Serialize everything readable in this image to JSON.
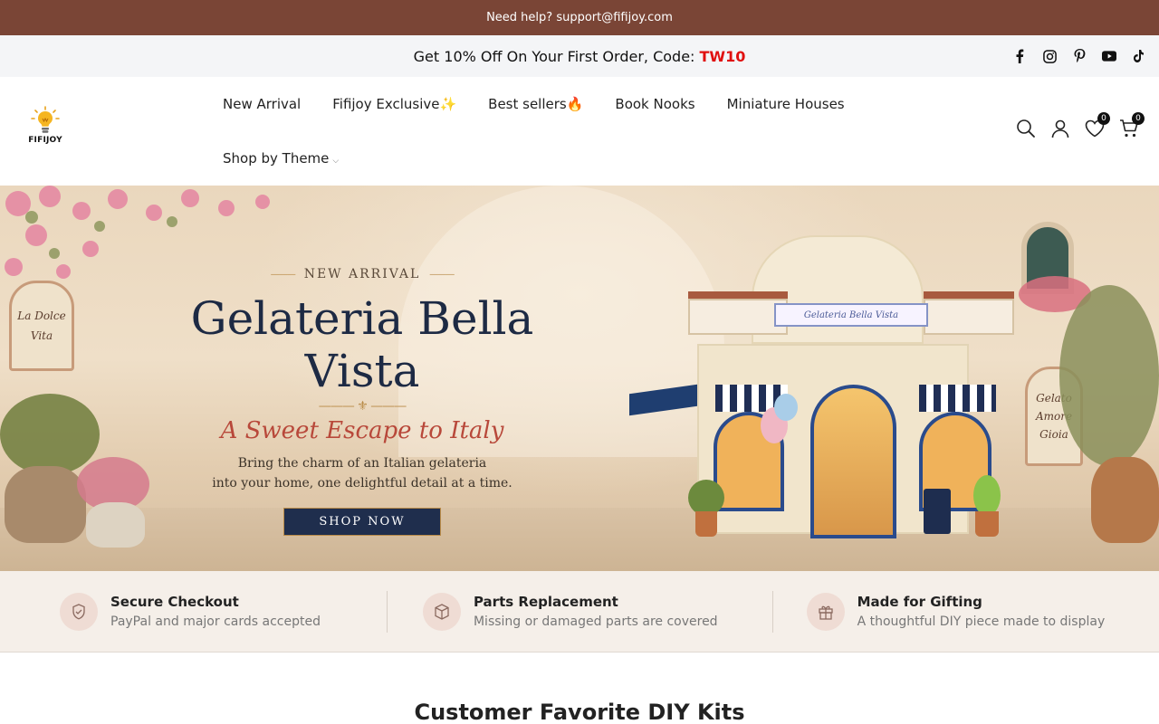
{
  "topbar": {
    "text": "Need help? support@fifijoy.com"
  },
  "promo": {
    "text": "Get 10% Off On Your First Order, Code: ",
    "code": "TW10"
  },
  "social": [
    "facebook-icon",
    "instagram-icon",
    "pinterest-icon",
    "youtube-icon",
    "tiktok-icon"
  ],
  "logo": {
    "name": "FIFIJOY",
    "tagline": ""
  },
  "nav": {
    "items": [
      "New Arrival",
      "Fifijoy Exclusive✨",
      "Best sellers🔥",
      "Book Nooks",
      "Miniature Houses"
    ],
    "shop_by_theme": "Shop by Theme"
  },
  "header_icons": {
    "wishlist_count": "0",
    "cart_count": "0"
  },
  "hero": {
    "kicker": "NEW ARRIVAL",
    "title": "Gelateria Bella Vista",
    "subtitle": "A Sweet Escape to Italy",
    "desc_line1": "Bring the charm of an Italian gelateria",
    "desc_line2": "into your home, one delightful detail at a time.",
    "cta": "SHOP NOW",
    "sign_text": "Gelateria Bella Vista",
    "plaque_left": "La Dolce Vita",
    "plaque_right": "Gelato Amore Gioia"
  },
  "features": [
    {
      "icon": "shield-check-icon",
      "title": "Secure Checkout",
      "desc": "PayPal and major cards accepted"
    },
    {
      "icon": "box-icon",
      "title": "Parts Replacement",
      "desc": "Missing or damaged parts are covered"
    },
    {
      "icon": "gift-icon",
      "title": "Made for Gifting",
      "desc": "A thoughtful DIY piece made to display"
    }
  ],
  "section": {
    "title": "Customer Favorite DIY Kits"
  },
  "colors": {
    "topbar": "#7a4536",
    "promo_code": "#e01010",
    "hero_title": "#1d2a44",
    "hero_sub": "#b8483a",
    "cta": "#1f2e4d",
    "feature_bg": "#f5efe9"
  }
}
